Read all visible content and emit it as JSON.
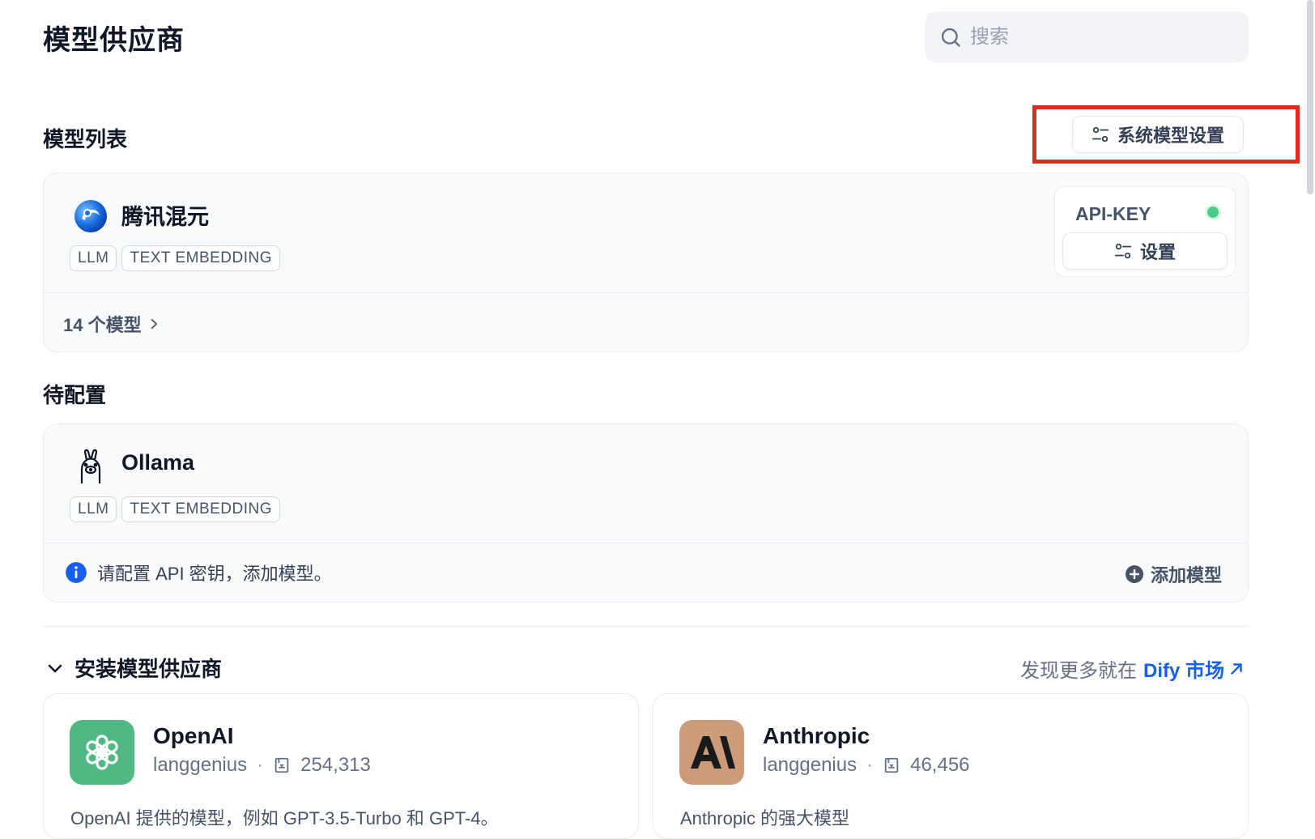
{
  "page": {
    "title": "模型供应商"
  },
  "search": {
    "placeholder": "搜索"
  },
  "model_list": {
    "title": "模型列表",
    "system_settings_label": "系统模型设置",
    "provider": {
      "name": "腾讯混元",
      "tags": [
        "LLM",
        "TEXT EMBEDDING"
      ],
      "api_key_label": "API-KEY",
      "settings_label": "设置",
      "models_count": "14 个模型",
      "status_color": "#47cd89"
    }
  },
  "pending": {
    "title": "待配置",
    "provider": {
      "name": "Ollama",
      "tags": [
        "LLM",
        "TEXT EMBEDDING"
      ],
      "notice": "请配置 API 密钥，添加模型。",
      "add_model_label": "添加模型"
    }
  },
  "install": {
    "title": "安装模型供应商",
    "discover_prefix": "发现更多就在",
    "discover_link": "Dify 市场",
    "providers": [
      {
        "name": "OpenAI",
        "author": "langgenius",
        "installs": "254,313",
        "description": "OpenAI 提供的模型，例如 GPT-3.5-Turbo 和 GPT-4。",
        "logo_color": "#4fb883"
      },
      {
        "name": "Anthropic",
        "author": "langgenius",
        "installs": "46,456",
        "description": "Anthropic 的强大模型",
        "logo_color": "#cc9b7a"
      }
    ]
  },
  "colors": {
    "accent": "#155eef",
    "highlight": "#d92d20"
  }
}
